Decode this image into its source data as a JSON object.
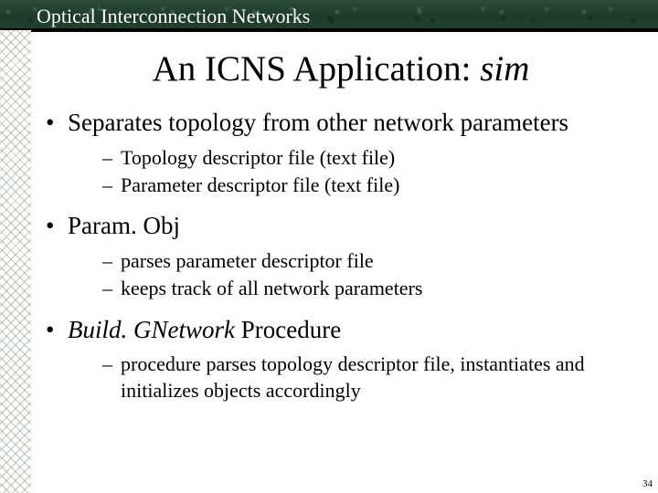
{
  "header": {
    "title": "Optical Interconnection Networks"
  },
  "title": {
    "prefix": "An ICNS Application: ",
    "ital": "sim"
  },
  "bullets": {
    "b1_a": "Separates topology from other network parameters",
    "sub_a1": "Topology descriptor file (text file)",
    "sub_a2": "Parameter descriptor file (text file)",
    "b1_b": "Param. Obj",
    "sub_b1": "parses parameter descriptor file",
    "sub_b2": "keeps track of all network parameters",
    "b1_c_ital": "Build. GNetwork",
    "b1_c_rest": " Procedure",
    "sub_c1": "procedure parses topology descriptor file, instantiates and initializes objects accordingly"
  },
  "page": "34"
}
